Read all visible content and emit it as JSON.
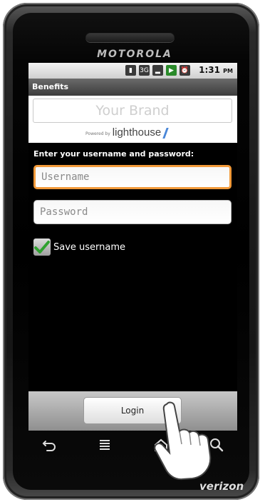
{
  "device": {
    "maker": "MOTOROLA",
    "carrier": "verizon"
  },
  "status_bar": {
    "time": "1:31",
    "ampm": "PM",
    "icons": [
      "sd-card-icon",
      "3g-icon",
      "signal-icon",
      "battery-icon",
      "alarm-icon"
    ]
  },
  "app": {
    "title": "Benefits",
    "brand_placeholder": "Your Brand",
    "powered_by_text": "Powered by",
    "powered_by_brand": "lighthouse",
    "prompt": "Enter your username and password:",
    "username_placeholder": "Username",
    "password_placeholder": "Password",
    "save_username_label": "Save username",
    "save_username_checked": true,
    "login_label": "Login"
  },
  "softkeys": [
    "back-icon",
    "menu-icon",
    "home-icon",
    "search-icon"
  ],
  "colors": {
    "focus_border": "#f29a3a",
    "check": "#2fa12f",
    "screen_bg": "#000000"
  }
}
